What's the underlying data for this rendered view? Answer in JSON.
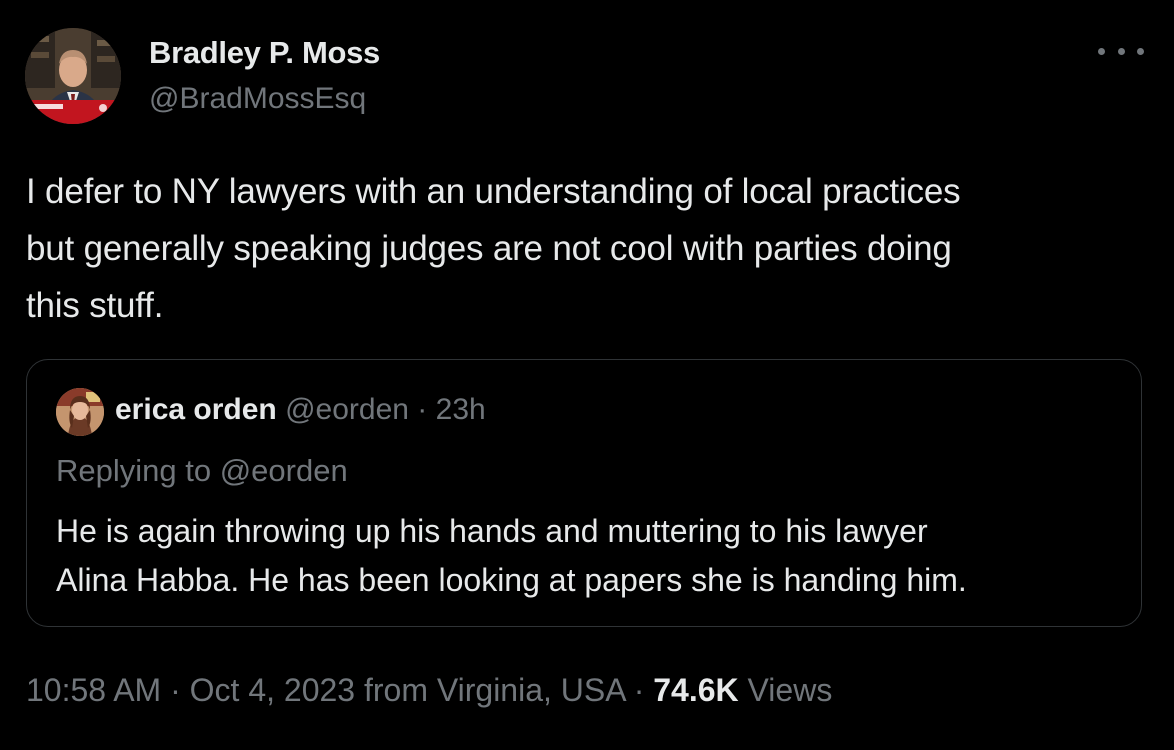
{
  "author": {
    "name": "Bradley P. Moss",
    "handle": "@BradMossEsq"
  },
  "tweet": {
    "text_lines": [
      "I defer to NY lawyers with an understanding of local practices",
      "but generally speaking judges are not cool with parties doing",
      "this stuff."
    ]
  },
  "more_icon": "more-horizontal-icon",
  "quoted_tweet": {
    "name": "erica orden",
    "handle": "@eorden",
    "separator": "·",
    "time": "23h",
    "replying_to": "Replying to @eorden",
    "text_lines": [
      "He is again throwing up his hands and muttering to his lawyer",
      "Alina Habba. He has been looking at papers she is handing him."
    ]
  },
  "meta": {
    "time": "10:58 AM",
    "separator": "·",
    "date": "Oct 4, 2023",
    "location": "from Virginia, USA",
    "views_count": "74.6K",
    "views_label": "Views"
  },
  "colors": {
    "background": "#000000",
    "primary_text": "#e7e9ea",
    "secondary_text": "#71767b",
    "border": "#2f3336"
  }
}
